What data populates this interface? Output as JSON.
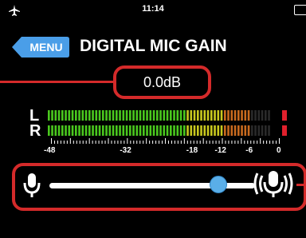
{
  "status_bar": {
    "time": "11:14",
    "airplane_icon": "airplane-icon",
    "battery_icon": "battery-icon"
  },
  "header": {
    "back_button_label": "MENU",
    "title": "DIGITAL MIC GAIN"
  },
  "gain": {
    "value": "0.0dB",
    "level_fraction": 0.82
  },
  "meter": {
    "channels": [
      "L",
      "R"
    ],
    "scale_labels": [
      "-48",
      "-32",
      "-18",
      "-12",
      "-6",
      "0"
    ],
    "scale_values": [
      -48,
      -32,
      -18,
      -12,
      -6,
      0
    ],
    "colors": {
      "low": "#4ac81e",
      "mid": "#c8c81e",
      "high": "#c86a1e",
      "peak": "#e0202c",
      "inactive": "#2a2a2a"
    }
  },
  "slider": {
    "min_icon": "microphone-icon",
    "max_icon": "microphone-loud-icon",
    "thumb_color": "#5aaee8"
  },
  "colors": {
    "accent": "#4a9ee8",
    "callout": "#d42a2a"
  }
}
